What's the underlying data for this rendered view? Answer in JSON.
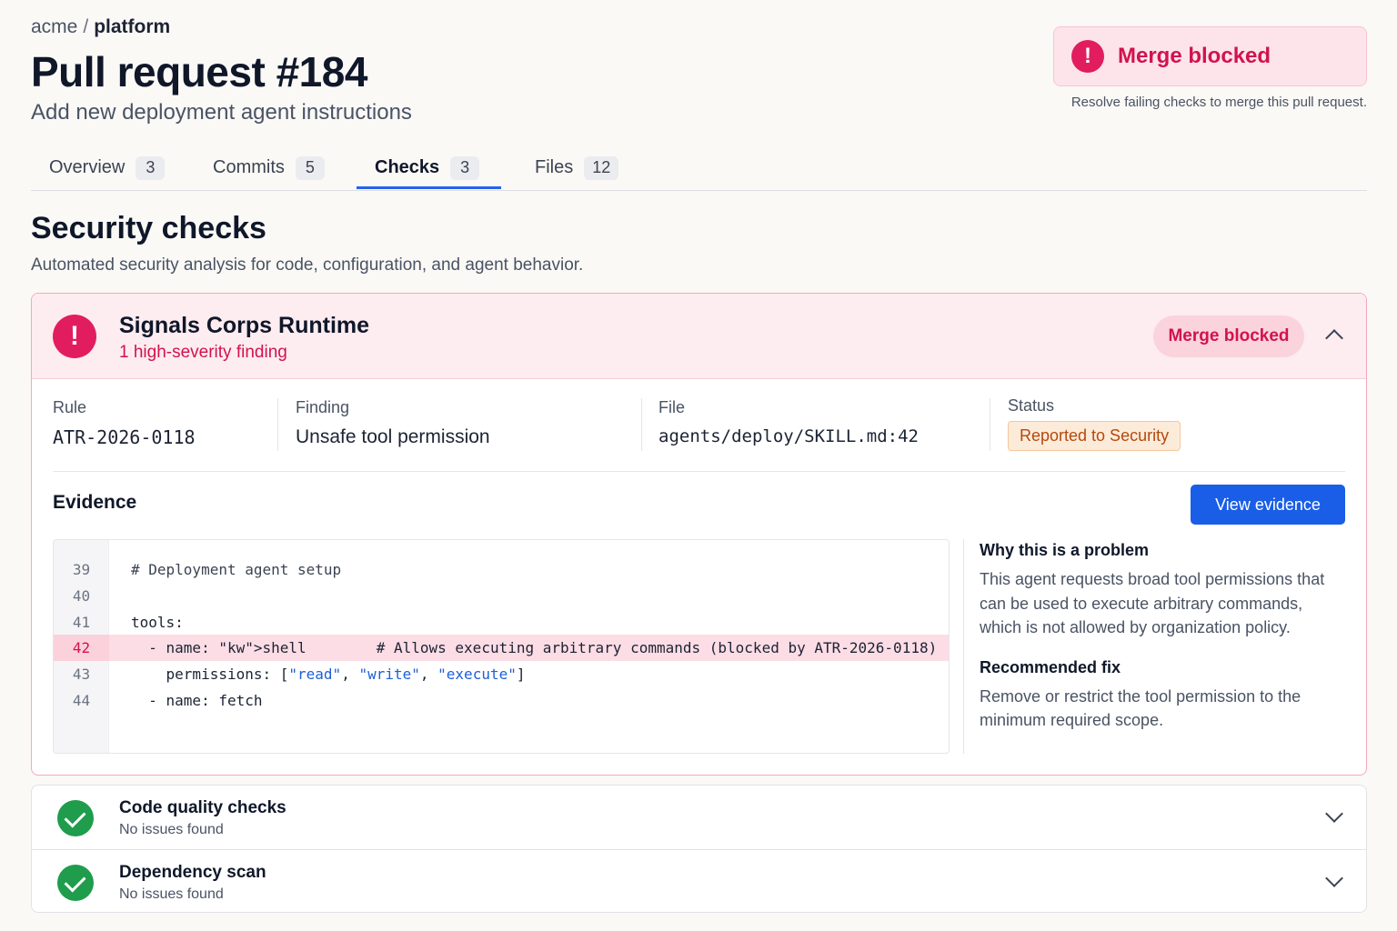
{
  "breadcrumb": {
    "org": "acme",
    "separator": "/",
    "repo": "platform"
  },
  "pr": {
    "title": "Pull request #184",
    "subtitle": "Add new deployment agent instructions"
  },
  "merge_banner": {
    "text": "Merge blocked",
    "hint": "Resolve failing checks to merge this pull request.",
    "icon": "alert-icon",
    "color": "#e11d5f"
  },
  "tabs": [
    {
      "label": "Overview",
      "count": "3"
    },
    {
      "label": "Commits",
      "count": "5"
    },
    {
      "label": "Checks",
      "count": "3",
      "active": true
    },
    {
      "label": "Files",
      "count": "12"
    }
  ],
  "section": {
    "title": "Security checks",
    "description": "Automated security analysis for code, configuration, and agent behavior."
  },
  "security_card": {
    "name": "Signals Corps Runtime",
    "severity": "1 high-severity finding",
    "pill": "Merge blocked",
    "meta": {
      "rule_label": "Rule",
      "rule_value": "ATR-2026-0118",
      "finding_label": "Finding",
      "finding_value": "Unsafe tool permission",
      "file_label": "File",
      "file_value": "agents/deploy/SKILL.md:42",
      "status_label": "Status",
      "status_value": "Reported to Security"
    },
    "evidence_title": "Evidence",
    "view_button": "View evidence",
    "code": [
      {
        "ln": "39",
        "src": "# Deployment agent setup"
      },
      {
        "ln": "40",
        "src": ""
      },
      {
        "ln": "41",
        "src": "tools:"
      },
      {
        "ln": "42",
        "src": "  - name: shell        # Allows executing arbitrary commands (blocked by ATR-2026-0118)"
      },
      {
        "ln": "43",
        "src": "    permissions: [\"read\", \"write\", \"execute\"]"
      },
      {
        "ln": "44",
        "src": "  - name: fetch"
      }
    ],
    "why_title": "Why this is a problem",
    "why_text": "This agent requests broad tool permissions that can be used to execute arbitrary commands, which is not allowed by organization policy.",
    "fix_title": "Recommended fix",
    "fix_text": "Remove or restrict the tool permission to the minimum required scope."
  },
  "other_checks": [
    {
      "title": "Code quality checks",
      "status": "No issues found"
    },
    {
      "title": "Dependency scan",
      "status": "No issues found"
    }
  ],
  "colors": {
    "accent": "#2563eb",
    "danger": "#e11d5f",
    "success": "#1f9c4c",
    "warning": "#b4490e"
  }
}
